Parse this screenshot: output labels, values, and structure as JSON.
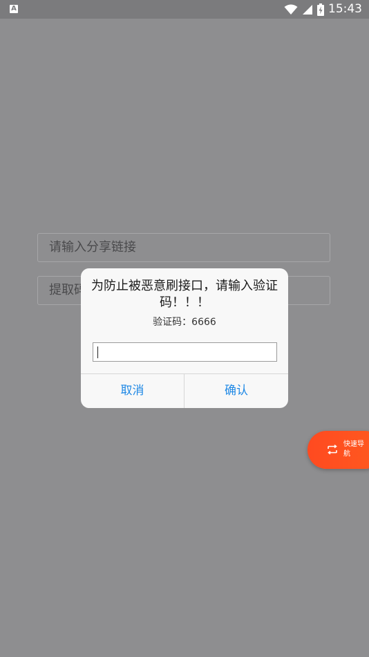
{
  "status_bar": {
    "left_badge": "A",
    "time": "15:43",
    "icons": [
      "wifi-icon",
      "signal-icon",
      "battery-icon"
    ]
  },
  "form": {
    "share_placeholder": "请输入分享链接",
    "code_placeholder": "提取码"
  },
  "dialog": {
    "title": "为防止被恶意刷接口，请输入验证码！！！",
    "message": "验证码：6666",
    "input_value": "",
    "cancel_label": "取消",
    "confirm_label": "确认"
  },
  "quick_nav": {
    "icon": "switch-icon",
    "label": "快速导航"
  },
  "colors": {
    "overlay_bg": "#8e8e90",
    "status_bar_bg": "#7b7b7d",
    "dialog_bg": "#f8f8f8",
    "button_text": "#1e88e5",
    "quick_nav_bg": "#ff4a20"
  }
}
